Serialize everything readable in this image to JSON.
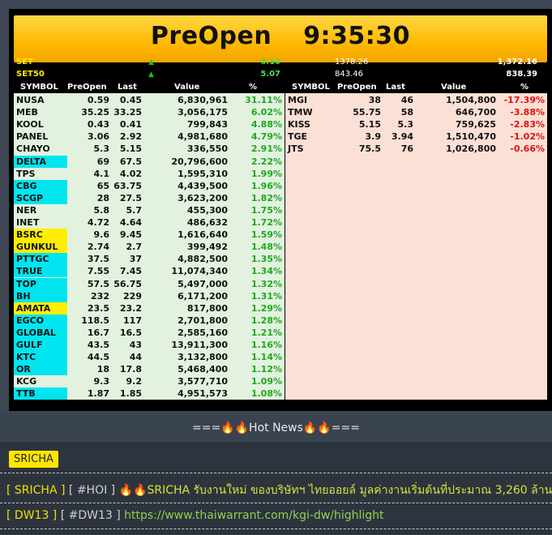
{
  "header": {
    "label": "PreOpen",
    "time": "9:35:30"
  },
  "indices": [
    {
      "name": "SET",
      "change": "6.10",
      "prev": "1378.26",
      "current": "1,372.16"
    },
    {
      "name": "SET50",
      "change": "5.07",
      "prev": "843.46",
      "current": "838.39"
    }
  ],
  "columns": [
    "SYMBOL",
    "PreOpen",
    "Last",
    "Value",
    "%"
  ],
  "left_rows": [
    {
      "symbol": "NUSA",
      "preopen": "0.59",
      "last": "0.45",
      "value": "6,830,961",
      "pct": "31.11%",
      "hl": ""
    },
    {
      "symbol": "MEB",
      "preopen": "35.25",
      "last": "33.25",
      "value": "3,056,175",
      "pct": "6.02%",
      "hl": ""
    },
    {
      "symbol": "KOOL",
      "preopen": "0.43",
      "last": "0.41",
      "value": "799,843",
      "pct": "4.88%",
      "hl": ""
    },
    {
      "symbol": "PANEL",
      "preopen": "3.06",
      "last": "2.92",
      "value": "4,981,680",
      "pct": "4.79%",
      "hl": ""
    },
    {
      "symbol": "CHAYO",
      "preopen": "5.3",
      "last": "5.15",
      "value": "336,550",
      "pct": "2.91%",
      "hl": ""
    },
    {
      "symbol": "DELTA",
      "preopen": "69",
      "last": "67.5",
      "value": "20,796,600",
      "pct": "2.22%",
      "hl": "cyan"
    },
    {
      "symbol": "TPS",
      "preopen": "4.1",
      "last": "4.02",
      "value": "1,595,310",
      "pct": "1.99%",
      "hl": ""
    },
    {
      "symbol": "CBG",
      "preopen": "65",
      "last": "63.75",
      "value": "4,439,500",
      "pct": "1.96%",
      "hl": "cyan"
    },
    {
      "symbol": "SCGP",
      "preopen": "28",
      "last": "27.5",
      "value": "3,623,200",
      "pct": "1.82%",
      "hl": "cyan"
    },
    {
      "symbol": "NER",
      "preopen": "5.8",
      "last": "5.7",
      "value": "455,300",
      "pct": "1.75%",
      "hl": ""
    },
    {
      "symbol": "INET",
      "preopen": "4.72",
      "last": "4.64",
      "value": "486,632",
      "pct": "1.72%",
      "hl": ""
    },
    {
      "symbol": "BSRC",
      "preopen": "9.6",
      "last": "9.45",
      "value": "1,616,640",
      "pct": "1.59%",
      "hl": "yellow"
    },
    {
      "symbol": "GUNKUL",
      "preopen": "2.74",
      "last": "2.7",
      "value": "399,492",
      "pct": "1.48%",
      "hl": "yellow"
    },
    {
      "symbol": "PTTGC",
      "preopen": "37.5",
      "last": "37",
      "value": "4,882,500",
      "pct": "1.35%",
      "hl": "cyan"
    },
    {
      "symbol": "TRUE",
      "preopen": "7.55",
      "last": "7.45",
      "value": "11,074,340",
      "pct": "1.34%",
      "hl": "cyan"
    },
    {
      "symbol": "TOP",
      "preopen": "57.5",
      "last": "56.75",
      "value": "5,497,000",
      "pct": "1.32%",
      "hl": "cyan"
    },
    {
      "symbol": "BH",
      "preopen": "232",
      "last": "229",
      "value": "6,171,200",
      "pct": "1.31%",
      "hl": "cyan"
    },
    {
      "symbol": "AMATA",
      "preopen": "23.5",
      "last": "23.2",
      "value": "817,800",
      "pct": "1.29%",
      "hl": "yellow"
    },
    {
      "symbol": "EGCO",
      "preopen": "118.5",
      "last": "117",
      "value": "2,701,800",
      "pct": "1.28%",
      "hl": "cyan"
    },
    {
      "symbol": "GLOBAL",
      "preopen": "16.7",
      "last": "16.5",
      "value": "2,585,160",
      "pct": "1.21%",
      "hl": "cyan"
    },
    {
      "symbol": "GULF",
      "preopen": "43.5",
      "last": "43",
      "value": "13,911,300",
      "pct": "1.16%",
      "hl": "cyan"
    },
    {
      "symbol": "KTC",
      "preopen": "44.5",
      "last": "44",
      "value": "3,132,800",
      "pct": "1.14%",
      "hl": "cyan"
    },
    {
      "symbol": "OR",
      "preopen": "18",
      "last": "17.8",
      "value": "5,468,400",
      "pct": "1.12%",
      "hl": "cyan"
    },
    {
      "symbol": "KCG",
      "preopen": "9.3",
      "last": "9.2",
      "value": "3,577,710",
      "pct": "1.09%",
      "hl": ""
    },
    {
      "symbol": "TTB",
      "preopen": "1.87",
      "last": "1.85",
      "value": "4,951,573",
      "pct": "1.08%",
      "hl": "cyan"
    }
  ],
  "right_rows": [
    {
      "symbol": "MGI",
      "preopen": "38",
      "last": "46",
      "value": "1,504,800",
      "pct": "-17.39%"
    },
    {
      "symbol": "TMW",
      "preopen": "55.75",
      "last": "58",
      "value": "646,700",
      "pct": "-3.88%"
    },
    {
      "symbol": "KISS",
      "preopen": "5.15",
      "last": "5.3",
      "value": "759,625",
      "pct": "-2.83%"
    },
    {
      "symbol": "TGE",
      "preopen": "3.9",
      "last": "3.94",
      "value": "1,510,470",
      "pct": "-1.02%"
    },
    {
      "symbol": "JTS",
      "preopen": "75.5",
      "last": "76",
      "value": "1,026,800",
      "pct": "-0.66%"
    }
  ],
  "news": {
    "title": "===🔥🔥Hot News🔥🔥===",
    "tag": "SRICHA",
    "items": [
      {
        "ticker": "[ SRICHA ]",
        "hashtag": "[ #HOI ]",
        "text": "🔥🔥SRICHA รับงานใหม่ ของบริษัทฯ ไทยออยล์ มูลค่างานเริ่มต้นที่ประมาณ 3,260 ล้าน"
      },
      {
        "ticker": "[ DW13 ]",
        "hashtag": "[ #DW13 ]",
        "text": "https://www.thaiwarrant.com/kgi-dw/highlight"
      }
    ]
  },
  "colors": {
    "up": "#1ea81e",
    "down": "#e01010",
    "banner": "#ffc20e",
    "cyan": "#00e5f0",
    "yellow": "#ffee00"
  }
}
